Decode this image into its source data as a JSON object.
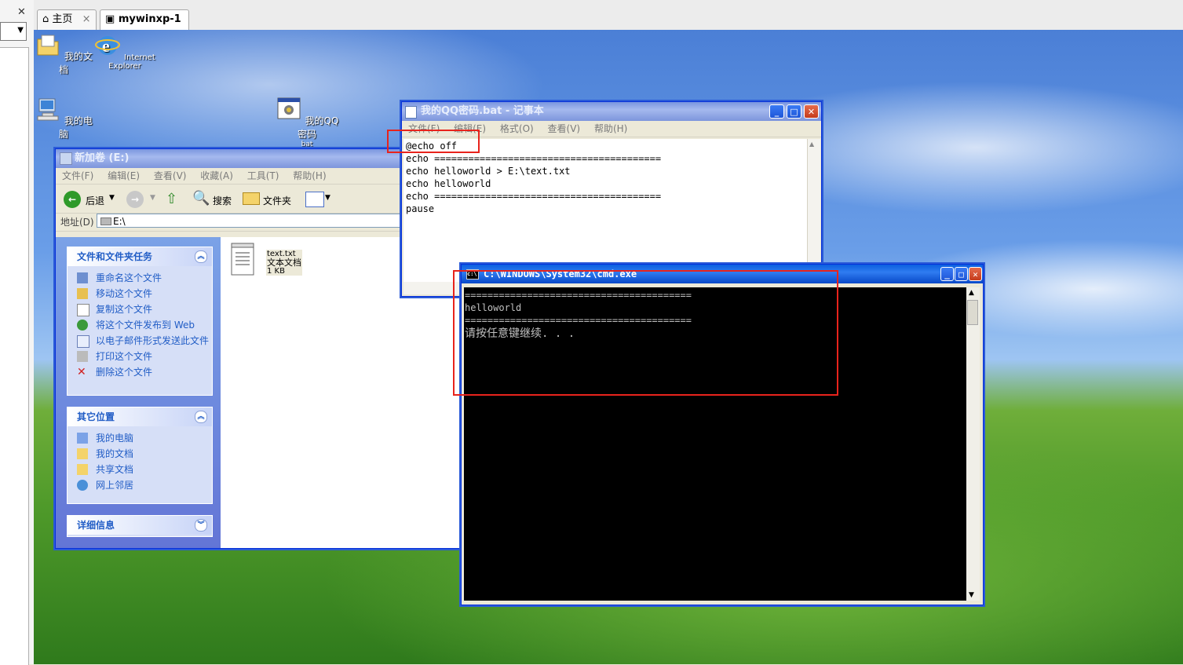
{
  "host": {
    "close_glyph": "✕",
    "tabs": [
      {
        "label": "主页",
        "icon": "home-icon"
      },
      {
        "label": "mywinxp-1",
        "icon": "vm-icon"
      }
    ],
    "tab_close": "×"
  },
  "desktop": {
    "icons": [
      {
        "label": "我的文档",
        "sub": "",
        "icon": "my-documents-icon"
      },
      {
        "label": "Internet",
        "sub": "Explorer",
        "icon": "internet-explorer-icon"
      },
      {
        "label": "我的电脑",
        "sub": "",
        "icon": "my-computer-icon"
      },
      {
        "label": "我的QQ密码",
        "sub": "bat",
        "icon": "batch-file-icon"
      }
    ]
  },
  "explorer": {
    "title": "新加卷 (E:)",
    "menu": [
      "文件(F)",
      "编辑(E)",
      "查看(V)",
      "收藏(A)",
      "工具(T)",
      "帮助(H)"
    ],
    "toolbar": {
      "back": "后退",
      "search": "搜索",
      "folders": "文件夹"
    },
    "address_label": "地址(D)",
    "address_value": "E:\\",
    "tasks_panel": {
      "title": "文件和文件夹任务",
      "items": [
        "重命名这个文件",
        "移动这个文件",
        "复制这个文件",
        "将这个文件发布到 Web",
        "以电子邮件形式发送此文件",
        "打印这个文件",
        "删除这个文件"
      ]
    },
    "places_panel": {
      "title": "其它位置",
      "items": [
        "我的电脑",
        "我的文档",
        "共享文档",
        "网上邻居"
      ]
    },
    "details_panel": {
      "title": "详细信息"
    },
    "file": {
      "name": "text.txt",
      "type": "文本文档",
      "size": "1 KB"
    }
  },
  "notepad": {
    "title": "我的QQ密码.bat - 记事本",
    "menu": [
      "文件(F)",
      "编辑(E)",
      "格式(O)",
      "查看(V)",
      "帮助(H)"
    ],
    "lines": [
      "@echo off",
      "echo ========================================",
      "echo helloworld > E:\\text.txt",
      "echo helloworld",
      "echo ========================================",
      "pause"
    ]
  },
  "cmd": {
    "title": "C:\\WINDOWS\\System32\\cmd.exe",
    "lines": [
      "========================================",
      "helloworld",
      "========================================"
    ],
    "prompt": "请按任意键继续. . ."
  },
  "colors": {
    "annotation": "#e8231c",
    "xp_title": "#0a5fdf",
    "task_link": "#215dc6"
  }
}
